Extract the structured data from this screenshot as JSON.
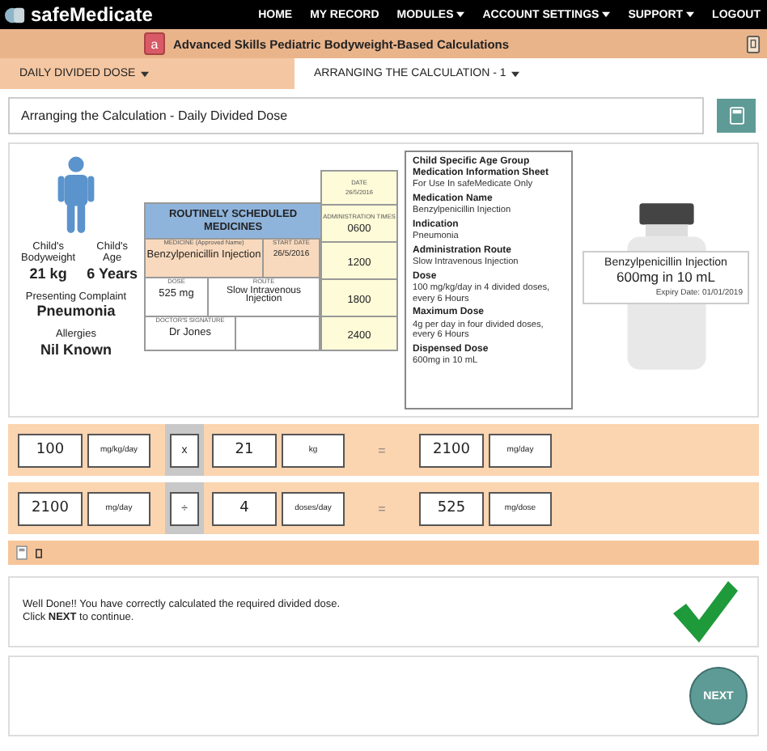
{
  "navbar": {
    "brand": "safeMedicate",
    "items": [
      {
        "label": "HOME",
        "dropdown": false
      },
      {
        "label": "MY RECORD",
        "dropdown": false
      },
      {
        "label": "MODULES",
        "dropdown": true
      },
      {
        "label": "ACCOUNT SETTINGS",
        "dropdown": true
      },
      {
        "label": "SUPPORT",
        "dropdown": true
      },
      {
        "label": "LOGOUT",
        "dropdown": false
      }
    ]
  },
  "banner": {
    "badge": "a",
    "title": "Advanced Skills Pediatric Bodyweight-Based Calculations"
  },
  "tabs": [
    {
      "label": "DAILY DIVIDED DOSE",
      "selected": true
    },
    {
      "label": "ARRANGING THE CALCULATION - 1",
      "selected": false
    }
  ],
  "page_title": "Arranging the Calculation - Daily Divided Dose",
  "patient": {
    "fields": [
      {
        "label": "Child's Bodyweight",
        "value": "21 kg"
      },
      {
        "label": "Child's Age",
        "value": "6 Years"
      }
    ],
    "complaint_label": "Presenting Complaint",
    "complaint": "Pneumonia",
    "allergies_label": "Allergies",
    "allergies": "Nil Known"
  },
  "chart": {
    "date_label": "DATE",
    "date": "26/5/2016",
    "times_label": "ADMINISTRATION TIMES",
    "times": [
      "0600",
      "1200",
      "1800",
      "2400"
    ],
    "heading": "ROUTINELY SCHEDULED MEDICINES",
    "medicine_label": "MEDICINE (Approved Name)",
    "medicine": "Benzylpenicillin Injection",
    "start_label": "START DATE",
    "start": "26/5/2016",
    "dose_label": "DOSE",
    "dose": "525 mg",
    "route_label": "ROUTE",
    "route": "Slow Intravenous Injection",
    "signature_label": "DOCTOR'S SIGNATURE",
    "signature": "Dr Jones"
  },
  "info_sheet": {
    "heading": [
      "Child Specific Age Group",
      "Medication Information Sheet"
    ],
    "subheading": "For Use In safeMedicate Only",
    "sections": [
      {
        "title": "Medication Name",
        "text": "Benzylpenicillin Injection"
      },
      {
        "title": "Indication",
        "text": "Pneumonia"
      },
      {
        "title": "Administration Route",
        "text": "Slow Intravenous Injection"
      },
      {
        "title": "Dose",
        "text": "100 mg/kg/day in 4 divided doses, every 6 Hours"
      },
      {
        "title": "Maximum Dose",
        "text": "4g per day in four divided doses, every 6 Hours"
      },
      {
        "title": "Dispensed Dose",
        "text": "600mg in 10 mL"
      }
    ]
  },
  "vial": {
    "name": "Benzylpenicillin Injection",
    "strength": "600mg in 10 mL",
    "expiry": "Expiry Date: 01/01/2019"
  },
  "calculations": [
    [
      {
        "kind": "value",
        "text": "100"
      },
      {
        "kind": "unit",
        "text": "mg/kg/day"
      },
      {
        "kind": "operator",
        "text": "x"
      },
      {
        "kind": "value",
        "text": "21"
      },
      {
        "kind": "unit",
        "text": "kg"
      },
      {
        "kind": "equals",
        "text": "="
      },
      {
        "kind": "value",
        "text": "2100"
      },
      {
        "kind": "unit",
        "text": "mg/day"
      }
    ],
    [
      {
        "kind": "value",
        "text": "2100"
      },
      {
        "kind": "unit",
        "text": "mg/day"
      },
      {
        "kind": "operator",
        "text": "÷"
      },
      {
        "kind": "value",
        "text": "4"
      },
      {
        "kind": "unit",
        "text": "doses/day"
      },
      {
        "kind": "equals",
        "text": "="
      },
      {
        "kind": "value",
        "text": "525"
      },
      {
        "kind": "unit",
        "text": "mg/dose"
      }
    ]
  ],
  "feedback": {
    "lines": [
      "Well Done!! You have correctly calculated the required divided dose.",
      "Click **NEXT** to continue."
    ],
    "correct": true
  },
  "next_button": "NEXT"
}
